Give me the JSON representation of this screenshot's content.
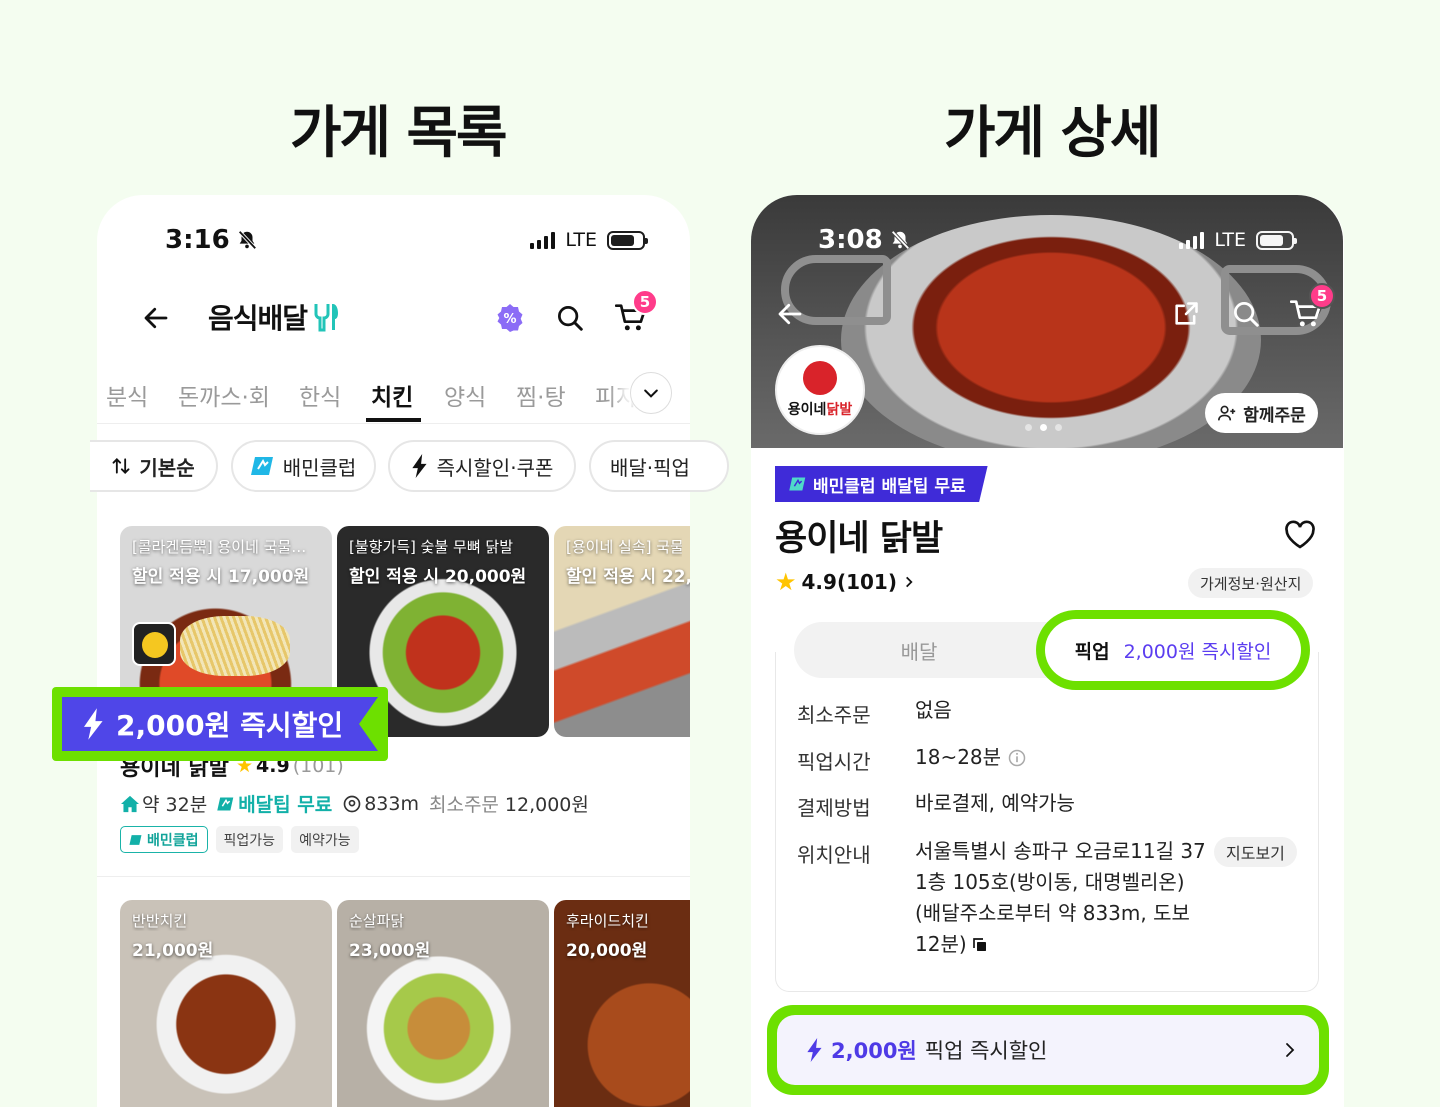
{
  "titles": {
    "left": "가게 목록",
    "right": "가게 상세"
  },
  "left_phone": {
    "status": {
      "time": "3:16",
      "network": "LTE"
    },
    "header": {
      "title": "음식배달",
      "cart_count": "5"
    },
    "categories": [
      "분식",
      "돈까스·회",
      "한식",
      "치킨",
      "양식",
      "찜·탕",
      "피자"
    ],
    "active_category": "치킨",
    "filters": {
      "sort": "기본순",
      "club": "배민클럽",
      "instant": "즉시할인·쿠폰",
      "delivery": "배달·픽업"
    },
    "store1": {
      "cards": [
        {
          "caption": "[콜라겐듬뿍] 용이네 국물…",
          "price": "할인 적용 시 17,000원"
        },
        {
          "caption": "[불향가득] 숯불 무뼈 닭발",
          "price": "할인 적용 시 20,000원"
        },
        {
          "caption": "[용이네 실속] 국물",
          "price": "할인 적용 시 22,0"
        }
      ],
      "discount_banner": "2,000원 즉시할인",
      "name": "용이네 닭발",
      "rating": "4.9",
      "review_count": "(101)",
      "delivery_time": "약 32분",
      "delivery_fee": "배달팁 무료",
      "distance": "833m",
      "min_order_label": "최소주문",
      "min_order": "12,000원",
      "tags": [
        "배민클럽",
        "픽업가능",
        "예약가능"
      ]
    },
    "store2": {
      "cards": [
        {
          "caption": "반반치킨",
          "price": "21,000원"
        },
        {
          "caption": "순살파닭",
          "price": "23,000원"
        },
        {
          "caption": "후라이드치킨",
          "price": "20,000원"
        }
      ]
    }
  },
  "right_phone": {
    "status": {
      "time": "3:08",
      "network": "LTE"
    },
    "cart_count": "5",
    "logo_text": "용이네",
    "logo_accent": "닭발",
    "together_order": "함께주문",
    "club_badge": "배민클럽 배달팁 무료",
    "store_name": "용이네 닭발",
    "rating": "4.9(101)",
    "info_chip": "가게정보·원산지",
    "tabs": {
      "delivery": "배달",
      "pickup": "픽업",
      "pickup_discount": "2,000원 즉시할인"
    },
    "info": {
      "min_order_label": "최소주문",
      "min_order": "없음",
      "pickup_time_label": "픽업시간",
      "pickup_time": "18~28분",
      "payment_label": "결제방법",
      "payment": "바로결제, 예약가능",
      "location_label": "위치안내",
      "location_lines": [
        "서울특별시 송파구 오금로11길 37",
        "1층 105호(방이동, 대명벨리온)",
        "(배달주소로부터 약 833m, 도보",
        "12분)"
      ],
      "map_button": "지도보기"
    },
    "pickup_banner": {
      "amount": "2,000원",
      "text": "픽업 즉시할인"
    }
  },
  "colors": {
    "highlight": "#6de000",
    "purple": "#4f46e8",
    "mint": "#12b0a8",
    "badge": "#ff3c8a"
  }
}
